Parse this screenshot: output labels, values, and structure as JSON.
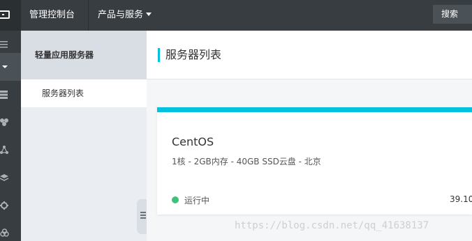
{
  "topbar": {
    "console_label": "管理控制台",
    "products_label": "产品与服务",
    "search_label": "搜索"
  },
  "sidebar": {
    "icons": [
      "menu-icon",
      "caret-down-icon",
      "server-stack-icon",
      "cubes-icon",
      "network-icon",
      "layers-icon",
      "gear-icon",
      "circles-icon"
    ]
  },
  "subnav": {
    "title": "轻量应用服务器",
    "items": [
      {
        "label": "服务器列表"
      }
    ]
  },
  "main": {
    "header_title": "服务器列表",
    "card": {
      "name": "CentOS",
      "spec": "1核 - 2GB内存 - 40GB SSD云盘 - 北京",
      "status": "运行中",
      "ip": "39.10"
    }
  },
  "watermark": "https://blog.csdn.net/qq_41638137",
  "colors": {
    "topbar": "#373d41",
    "accent": "#00c1de",
    "status_running": "#3dc17c",
    "subnav_bg": "#eaedf1"
  }
}
